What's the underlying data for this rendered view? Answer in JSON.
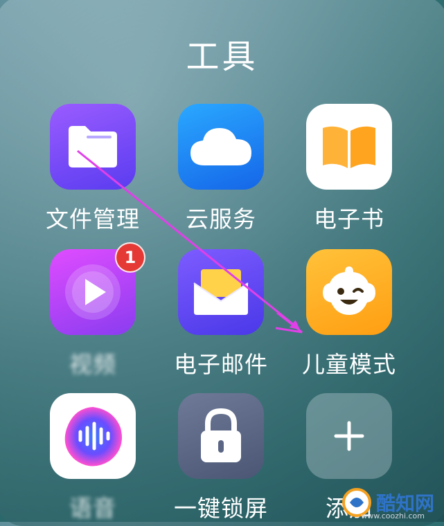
{
  "folder": {
    "title": "工具"
  },
  "apps": [
    {
      "label": "文件管理",
      "icon": "folder-icon",
      "color": "#7b4dff"
    },
    {
      "label": "云服务",
      "icon": "cloud-icon",
      "color": "#1e88ff"
    },
    {
      "label": "电子书",
      "icon": "book-icon",
      "color": "#ffffff"
    },
    {
      "label": "视频",
      "icon": "play-icon",
      "color": "#c040ff",
      "badge": "1"
    },
    {
      "label": "电子邮件",
      "icon": "mail-icon",
      "color": "#6b4dff"
    },
    {
      "label": "儿童模式",
      "icon": "child-face-icon",
      "color": "#ffb020"
    },
    {
      "label": "语音",
      "icon": "voice-wave-icon",
      "color": "#ffffff"
    },
    {
      "label": "一键锁屏",
      "icon": "lock-icon",
      "color": "#5a6b8a"
    },
    {
      "label": "添加",
      "icon": "plus-icon",
      "color": "#8aa0a8"
    }
  ],
  "annotation": {
    "arrow_color": "#e040e8",
    "arrow_icon": "arrow-annotation"
  },
  "watermark": {
    "text": "酷知网",
    "sub": "www.coozhi.com",
    "logo": "coozhi-logo-icon"
  }
}
